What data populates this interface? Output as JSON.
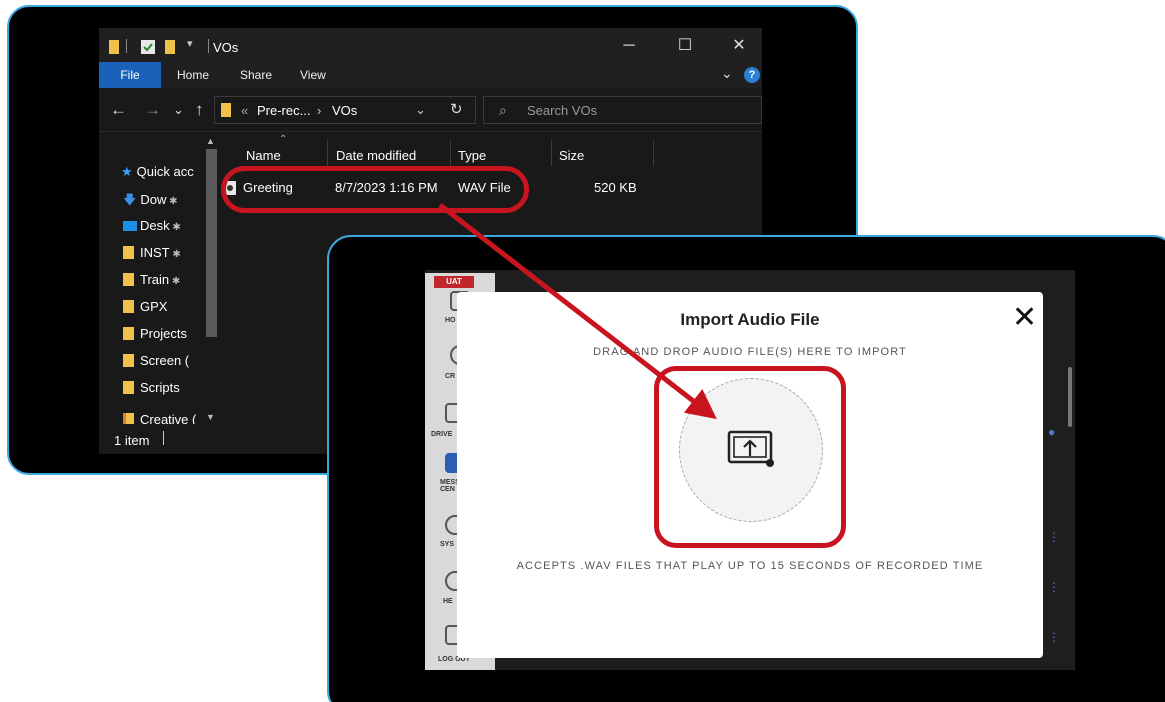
{
  "explorer": {
    "window_title": "VOs",
    "ribbon_tabs": [
      "File",
      "Home",
      "Share",
      "View"
    ],
    "help_label": "?",
    "address": {
      "prefix": "«",
      "crumb1": "Pre-rec...",
      "separator": "›",
      "crumb2": "VOs"
    },
    "search_placeholder": "Search VOs",
    "sidebar": [
      {
        "label": "Quick acc",
        "icon": "star-icon",
        "color": "#3aa0ff"
      },
      {
        "label": "Dow",
        "icon": "download-icon",
        "color": "#3a8fe8",
        "pinned": true
      },
      {
        "label": "Desk",
        "icon": "desktop-icon",
        "color": "#1f8fe6",
        "pinned": true
      },
      {
        "label": "INST",
        "icon": "folder-icon",
        "color": "#f0c24a",
        "pinned": true
      },
      {
        "label": "Train",
        "icon": "folder-icon",
        "color": "#f0c24a",
        "pinned": true
      },
      {
        "label": "GPX",
        "icon": "folder-icon",
        "color": "#f0c24a"
      },
      {
        "label": "Projects",
        "icon": "folder-icon",
        "color": "#f0c24a"
      },
      {
        "label": "Screen (",
        "icon": "folder-icon",
        "color": "#f0c24a"
      },
      {
        "label": "Scripts",
        "icon": "folder-icon",
        "color": "#f0c24a"
      },
      {
        "label": "Creative (",
        "icon": "creative-cloud-folder-icon",
        "color": "#f0c24a"
      }
    ],
    "columns": [
      "Name",
      "Date modified",
      "Type",
      "Size"
    ],
    "files": [
      {
        "name": "Greeting",
        "date_modified": "8/7/2023 1:16 PM",
        "type": "WAV File",
        "size": "520 KB"
      }
    ],
    "status": "1 item"
  },
  "app": {
    "env_badge": "UAT",
    "nav_labels": [
      "HO",
      "CR",
      "DRIVE",
      "MESS CEN",
      "SYS",
      "HE",
      "LOG OUT"
    ]
  },
  "dialog": {
    "title": "Import Audio File",
    "instruction": "DRAG AND DROP AUDIO FILE(S) HERE TO IMPORT",
    "footer": "ACCEPTS .WAV FILES THAT PLAY UP TO 15 SECONDS OF RECORDED TIME",
    "close_icon": "close-icon",
    "upload_icon": "upload-screen-icon"
  },
  "annotations": {
    "highlight_color": "#c8141e"
  }
}
